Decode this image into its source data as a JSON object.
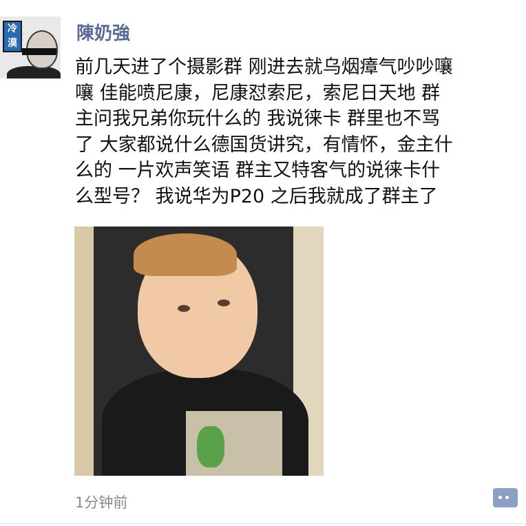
{
  "post": {
    "author": "陳奶強",
    "avatar_badge": "冷漠",
    "text_lines": [
      "前几天进了个摄影群 刚进去就乌烟瘴气吵吵嚷",
      "嚷 佳能喷尼康，尼康怼索尼，索尼日天地 群",
      "主问我兄弟你玩什么的 我说徕卡 群里也不骂",
      "了 大家都说什么德国货讲究，有情怀，金主什",
      "么的 一片欢声笑语 群主又特客气的说徕卡什",
      "么型号？ 我说华为P20 之后我就成了群主了"
    ],
    "image_icon": "photo-boy-side-eye",
    "timestamp": "1分钟前",
    "comment_icon": "comment-bubble-icon"
  },
  "colors": {
    "author_name": "#576b95",
    "text": "#111111",
    "timestamp": "#8a8a8a",
    "comment_button": "#8ba0c3"
  }
}
